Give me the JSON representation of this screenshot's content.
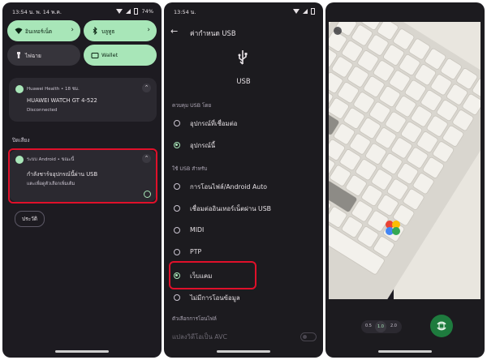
{
  "panel1": {
    "status": {
      "time_date": "13:54 น.   พ. 14 พ.ค.",
      "battery": "74%"
    },
    "tiles": [
      {
        "label": "อินเทอร์เน็ต",
        "icon": "wifi-icon",
        "state": "on"
      },
      {
        "label": "บลูทูธ",
        "icon": "bluetooth-icon",
        "state": "on"
      },
      {
        "label": "ไฟฉาย",
        "icon": "flashlight-icon",
        "state": "off"
      },
      {
        "label": "Wallet",
        "icon": "wallet-icon",
        "state": "on"
      }
    ],
    "health": {
      "app_line": "Huawei Health • 18 ชม.",
      "title": "HUAWEI WATCH GT 4-522",
      "text": "Disconnected"
    },
    "silent_header": "ปิดเสียง",
    "usb_notif": {
      "app_line": "ระบบ Android • ขณะนี้",
      "title": "กำลังชาร์จอุปกรณ์นี้ผ่าน USB",
      "text": "แตะเพื่อดูตัวเลือกเพิ่มเติม"
    },
    "history_button": "ประวัติ"
  },
  "panel2": {
    "status": {
      "time": "13:54 น."
    },
    "toolbar_title": "ค่ากำหนด USB",
    "usb_label": "USB",
    "section_control": "ควบคุม USB โดย",
    "control_options": [
      {
        "label": "อุปกรณ์ที่เชื่อมต่อ",
        "selected": false
      },
      {
        "label": "อุปกรณ์นี้",
        "selected": true
      }
    ],
    "section_use": "ใช้ USB สำหรับ",
    "use_options": [
      {
        "label": "การโอนไฟล์/Android Auto",
        "selected": false
      },
      {
        "label": "เชื่อมต่ออินเทอร์เน็ตผ่าน USB",
        "selected": false
      },
      {
        "label": "MIDI",
        "selected": false
      },
      {
        "label": "PTP",
        "selected": false
      },
      {
        "label": "เว็บแคม",
        "selected": true
      },
      {
        "label": "ไม่มีการโอนข้อมูล",
        "selected": false
      }
    ],
    "section_transfer": "ตัวเลือกการโอนไฟล์",
    "avc_label": "แปลงวิดีโอเป็น AVC",
    "avc_toggle": false
  },
  "panel3": {
    "zoom_levels": [
      "0.5",
      "1.0",
      "2.0"
    ],
    "zoom_selected": "1.0"
  },
  "colors": {
    "accent": "#a8e6b8",
    "highlight": "#e0102a",
    "surface": "#1c1b1f"
  }
}
